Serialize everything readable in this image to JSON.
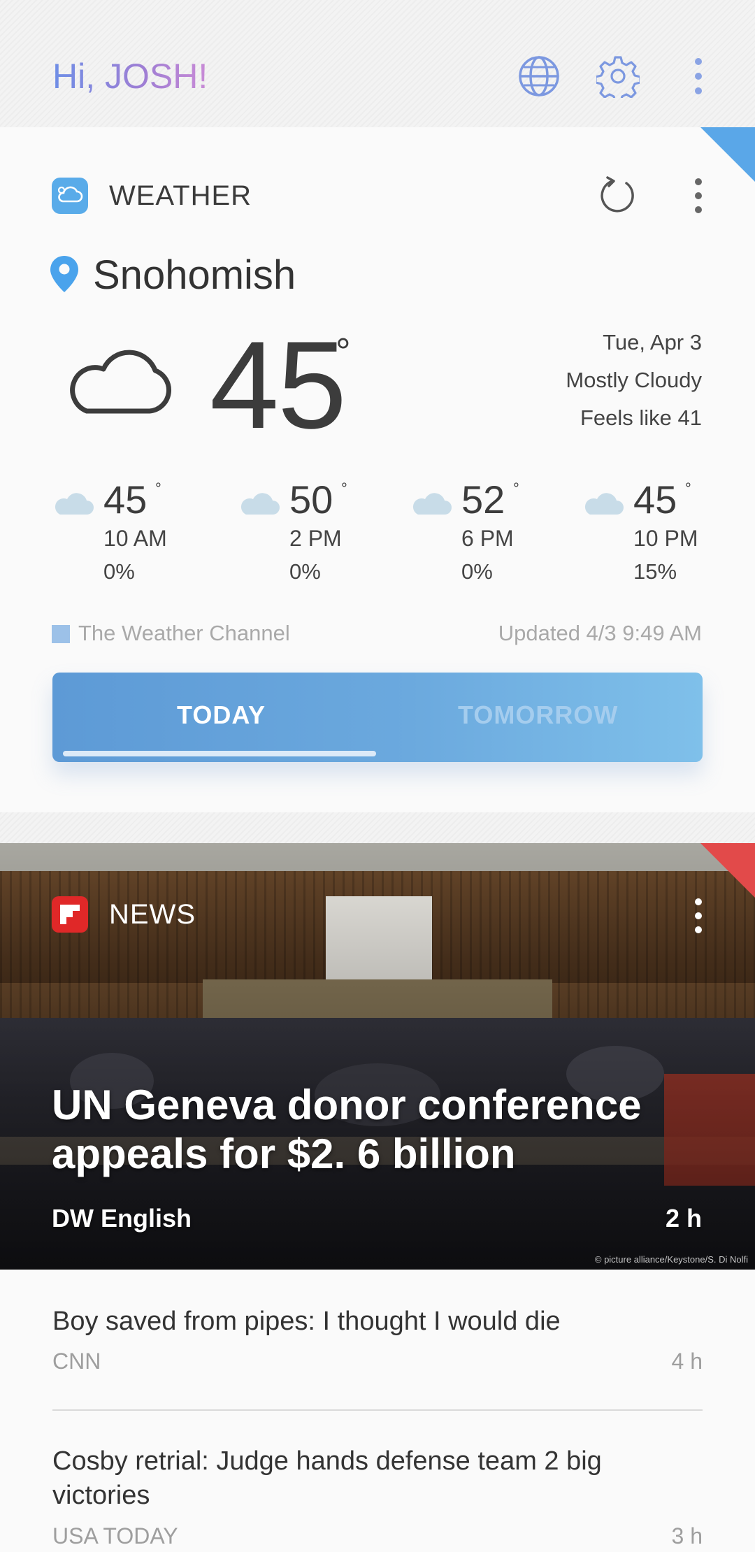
{
  "header": {
    "greeting": "Hi, JOSH!",
    "icons": [
      "globe-icon",
      "gear-icon",
      "more-vert-icon"
    ]
  },
  "weather": {
    "title": "WEATHER",
    "location": "Snohomish",
    "temperature": "45",
    "degree": "°",
    "condition_icon": "cloud-icon",
    "date": "Tue, Apr 3",
    "condition": "Mostly Cloudy",
    "feels_like": "Feels like 41",
    "hourly": [
      {
        "temp": "45",
        "deg": "°",
        "time": "10 AM",
        "precip": "0%"
      },
      {
        "temp": "50",
        "deg": "°",
        "time": "2 PM",
        "precip": "0%"
      },
      {
        "temp": "52",
        "deg": "°",
        "time": "6 PM",
        "precip": "0%"
      },
      {
        "temp": "45",
        "deg": "°",
        "time": "10 PM",
        "precip": "15%"
      }
    ],
    "source": "The Weather Channel",
    "updated": "Updated 4/3 9:49 AM",
    "tabs": {
      "today": "TODAY",
      "tomorrow": "TOMORROW"
    },
    "accent_color": "#5aa7e8"
  },
  "news": {
    "title": "NEWS",
    "accent_color": "#e24a4a",
    "hero": {
      "headline": "UN Geneva donor conference appeals for $2. 6 billion",
      "source": "DW English",
      "age": "2 h",
      "credit": "© picture alliance/Keystone/S. Di Nolfi"
    },
    "stories": [
      {
        "title": "Boy saved from pipes: I thought I would die",
        "source": "CNN",
        "age": "4 h"
      },
      {
        "title": "Cosby retrial: Judge hands defense team 2 big victories",
        "source": "USA TODAY",
        "age": "3 h"
      }
    ]
  }
}
